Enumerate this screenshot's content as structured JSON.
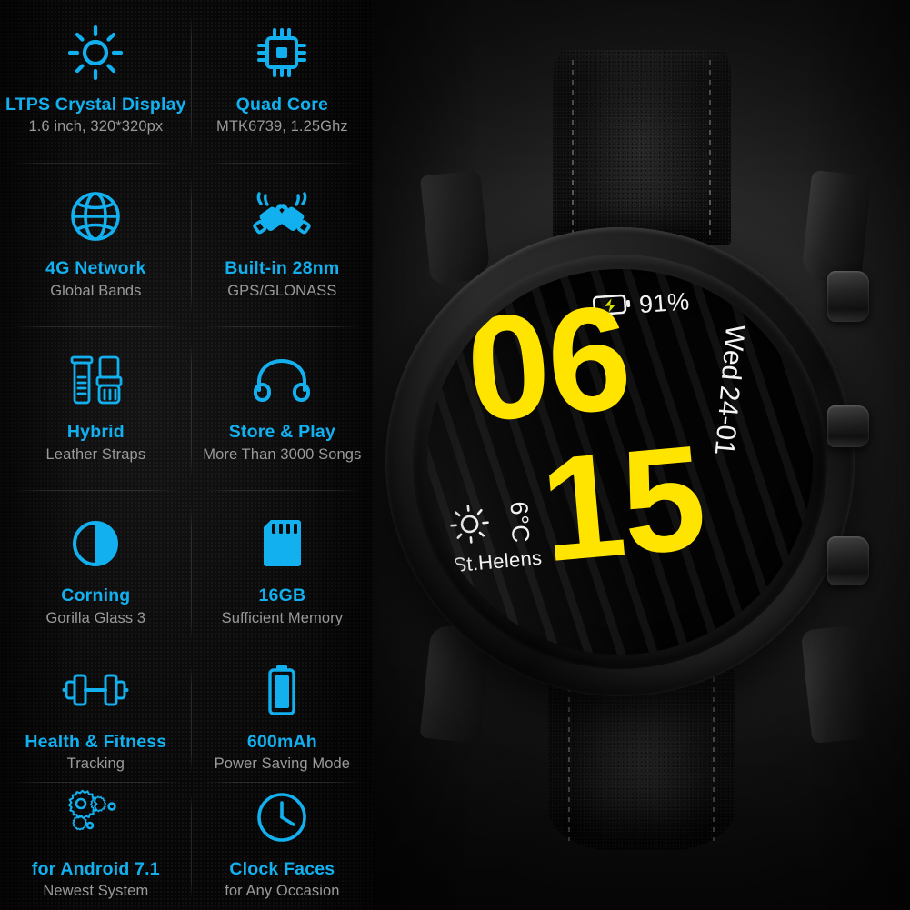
{
  "features": [
    {
      "icon": "brightness-sun-icon",
      "title": "LTPS Crystal Display",
      "subtitle": "1.6 inch, 320*320px"
    },
    {
      "icon": "cpu-chip-icon",
      "title": "Quad Core",
      "subtitle": "MTK6739, 1.25Ghz"
    },
    {
      "icon": "globe-icon",
      "title": "4G Network",
      "subtitle": "Global Bands"
    },
    {
      "icon": "satellite-icon",
      "title": "Built-in 28nm",
      "subtitle": "GPS/GLONASS"
    },
    {
      "icon": "watch-straps-icon",
      "title": "Hybrid",
      "subtitle": "Leather Straps"
    },
    {
      "icon": "headphones-icon",
      "title": "Store & Play",
      "subtitle": "More Than 3000 Songs"
    },
    {
      "icon": "contrast-circle-icon",
      "title": "Corning",
      "subtitle": "Gorilla Glass 3"
    },
    {
      "icon": "memory-card-icon",
      "title": "16GB",
      "subtitle": "Sufficient Memory"
    },
    {
      "icon": "dumbbell-icon",
      "title": "Health & Fitness",
      "subtitle": "Tracking"
    },
    {
      "icon": "battery-vertical-icon",
      "title": "600mAh",
      "subtitle": "Power Saving Mode"
    },
    {
      "icon": "gears-icon",
      "title": "for Android 7.1",
      "subtitle": "Newest System"
    },
    {
      "icon": "clock-icon",
      "title": "Clock Faces",
      "subtitle": "for Any Occasion"
    }
  ],
  "watch": {
    "screen": {
      "battery_icon": "battery-charging-icon",
      "battery_percent": "91%",
      "hours": "06",
      "minutes": "15",
      "weekday": "Wed",
      "date": "24-01",
      "weather_icon": "sun-icon",
      "temperature": "6°C",
      "city": "St.Helens"
    },
    "buttons": [
      {
        "name": "top-crown-button"
      },
      {
        "name": "middle-crown-button"
      },
      {
        "name": "bottom-crown-button"
      }
    ]
  },
  "colors": {
    "accent": "#13b0ef",
    "subtitle": "#9a9a9a",
    "watch_time": "#ffe400",
    "screen_text": "#f2f2f2",
    "panel_background": "#080808"
  }
}
